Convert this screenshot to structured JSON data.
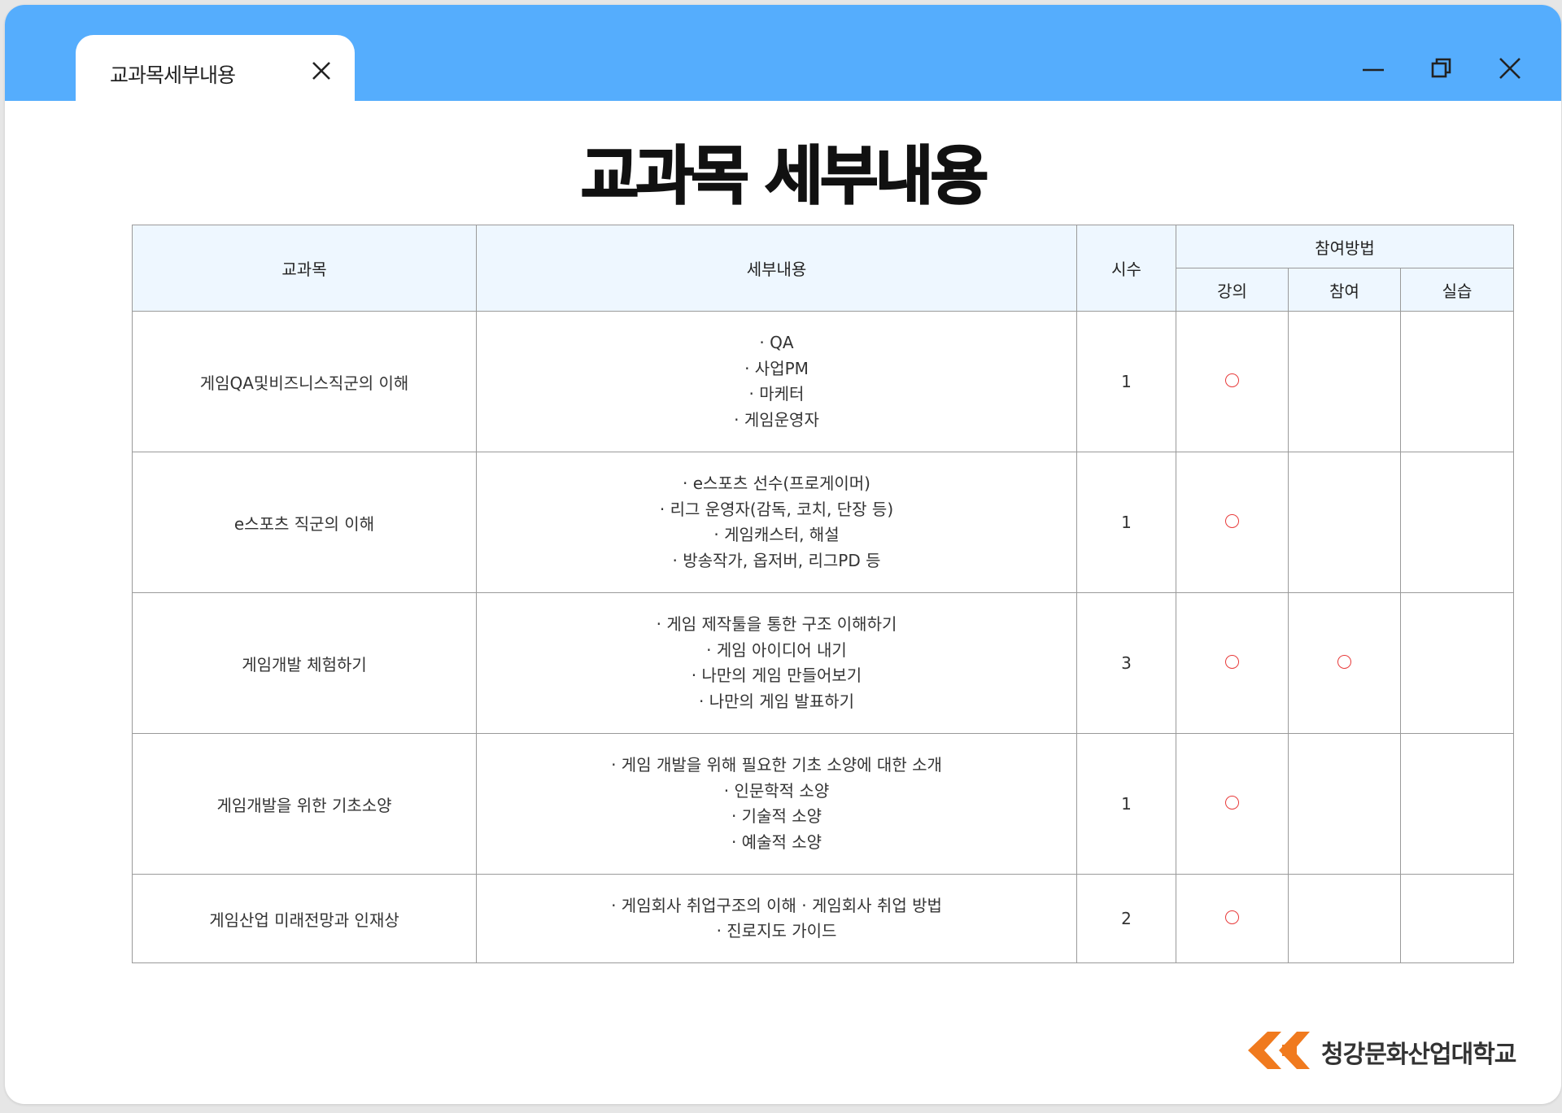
{
  "window": {
    "tab_title": "교과목세부내용",
    "controls": [
      "minimize-icon",
      "restore-icon",
      "close-icon"
    ],
    "accent_color": "#55adfd"
  },
  "page": {
    "title": "교과목 세부내용"
  },
  "table": {
    "headers": {
      "subject": "교과목",
      "details": "세부내용",
      "hours": "시수",
      "method": "참여방법",
      "method_lecture": "강의",
      "method_participation": "참여",
      "method_practice": "실습"
    },
    "mark_symbol": "circle",
    "mark_color": "#e83a3a",
    "rows": [
      {
        "subject": "게임QA및비즈니스직군의 이해",
        "details": [
          "· QA",
          "· 사업PM",
          "· 마케터",
          "· 게임운영자"
        ],
        "hours": "1",
        "lecture": true,
        "participation": false,
        "practice": false
      },
      {
        "subject": "e스포츠 직군의 이해",
        "details": [
          "· e스포츠 선수(프로게이머)",
          "· 리그 운영자(감독, 코치, 단장 등)",
          "· 게임캐스터, 해설",
          "· 방송작가, 옵저버, 리그PD 등"
        ],
        "hours": "1",
        "lecture": true,
        "participation": false,
        "practice": false
      },
      {
        "subject": "게임개발 체험하기",
        "details": [
          "· 게임 제작툴을 통한 구조 이해하기",
          "· 게임 아이디어 내기",
          "· 나만의 게임 만들어보기",
          "· 나만의 게임 발표하기"
        ],
        "hours": "3",
        "lecture": true,
        "participation": true,
        "practice": false
      },
      {
        "subject": "게임개발을 위한 기초소양",
        "details": [
          "· 게임 개발을 위해 필요한 기초 소양에 대한 소개",
          "· 인문학적 소양",
          "· 기술적 소양",
          "· 예술적 소양"
        ],
        "hours": "1",
        "lecture": true,
        "participation": false,
        "practice": false
      },
      {
        "subject": "게임산업 미래전망과 인재상",
        "details": [
          "· 게임회사 취업구조의 이해 · 게임회사 취업 방법",
          "· 진로지도 가이드"
        ],
        "hours": "2",
        "lecture": true,
        "participation": false,
        "practice": false
      }
    ]
  },
  "logo": {
    "text": "청강문화산업대학교",
    "brand_color": "#f07a1e"
  }
}
